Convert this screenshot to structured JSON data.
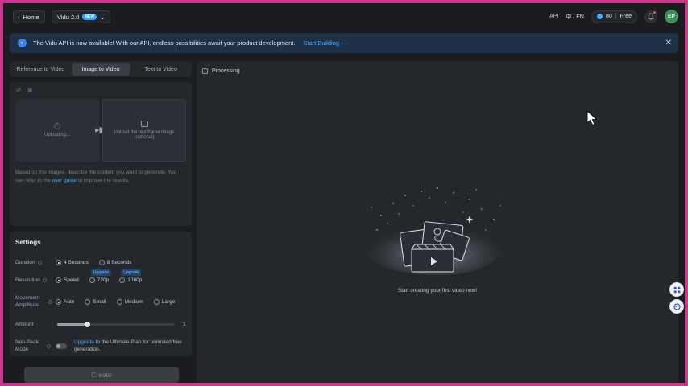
{
  "header": {
    "home_label": "Home",
    "model_label": "Vidu 2.0",
    "new_badge": "NEW",
    "api_label": "API",
    "lang_label": "中 / EN",
    "credits_amount": "80",
    "credits_plan": "Free",
    "avatar_initials": "EP"
  },
  "banner": {
    "message": "The Vidu API is now available! With our API, endless possibilities await your product development.",
    "link_label": "Start Building"
  },
  "tabs": [
    {
      "label": "Reference to Video"
    },
    {
      "label": "Image to Video"
    },
    {
      "label": "Text to Video"
    }
  ],
  "upload": {
    "first_frame_status": "Uploading...",
    "last_frame_label": "Upload the last frame image",
    "last_frame_hint": "(optional)",
    "prompt_before": "Based on the images, describe the content you want to generate. You can refer to the",
    "prompt_link": "user guide",
    "prompt_after": "to improve the results."
  },
  "settings": {
    "title": "Settings",
    "duration_label": "Duration",
    "duration_options": [
      "4 Seconds",
      "8 Seconds"
    ],
    "resolution_label": "Resolution",
    "resolution_options": [
      "Speed",
      "720p",
      "1080p"
    ],
    "upgrade_tag": "Upgrade",
    "movement_label": "Movement Amplitude",
    "movement_options": [
      "Auto",
      "Small",
      "Medium",
      "Large"
    ],
    "amount_label": "Amount",
    "amount_value": "1",
    "amount_fraction": 0.26,
    "nonpeak_label": "Non-Peak Mode",
    "nonpeak_link": "Upgrade",
    "nonpeak_text": "to the Ultimate Plan for unlimited free generation."
  },
  "create_label": "Create",
  "main": {
    "processing_label": "Processing",
    "empty_message": "Start creating your first video now!"
  },
  "colors": {
    "accent": "#4aa8ff",
    "panel": "#24272c",
    "background": "#1a1c20",
    "banner": "#1f3148"
  }
}
